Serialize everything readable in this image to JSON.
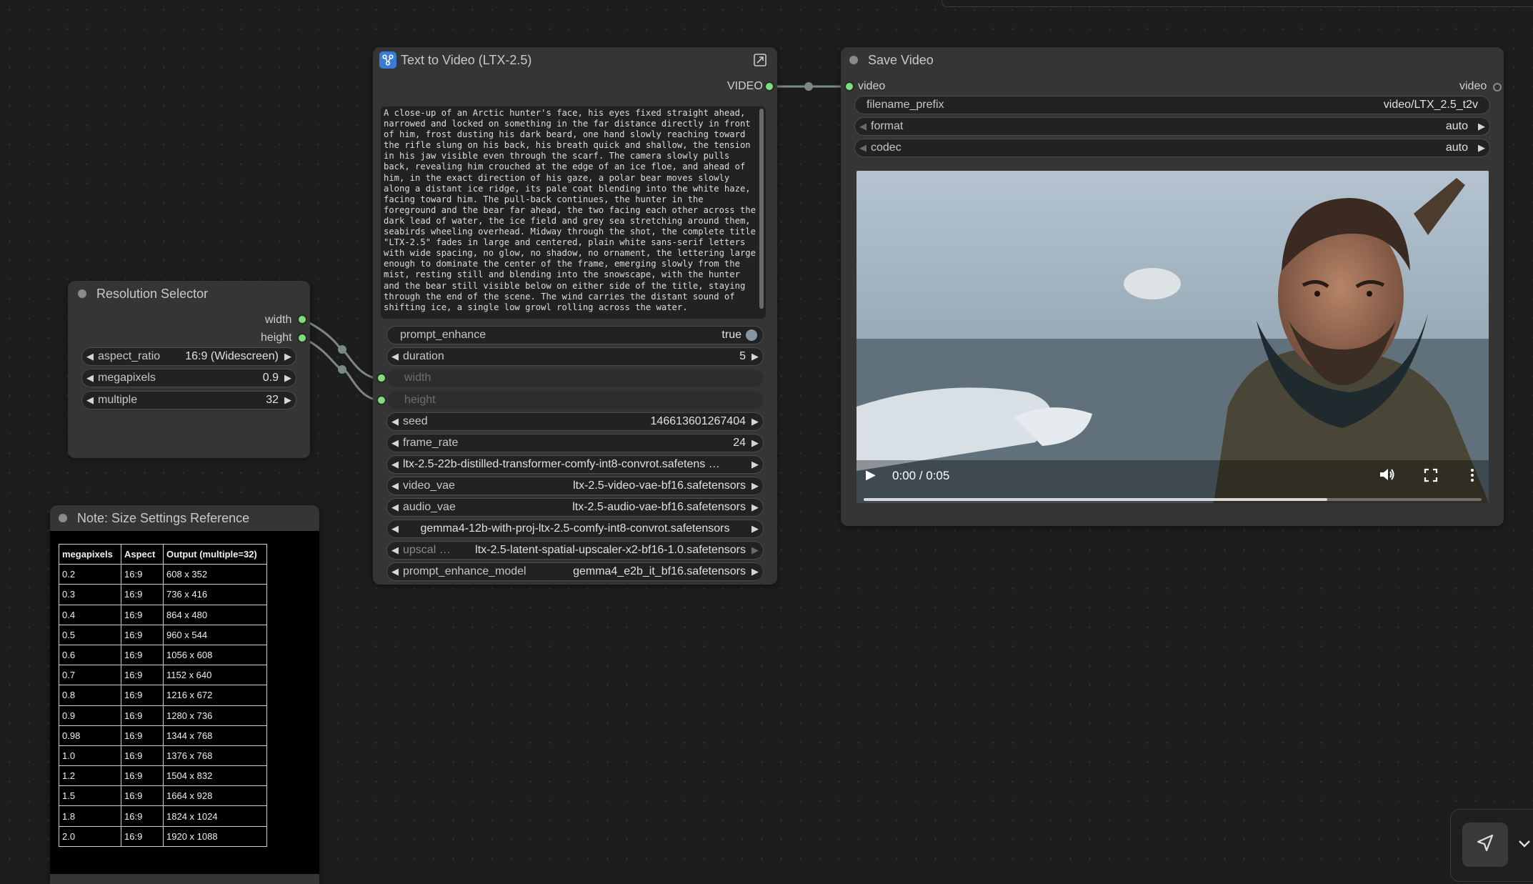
{
  "canvas": {
    "background": "#1d1d1d",
    "link_color": "#7a8a80"
  },
  "text_to_video": {
    "title": "Text to Video (LTX-2.5)",
    "output_label": "VIDEO",
    "prompt": "A close-up of an Arctic hunter's face, his eyes fixed straight ahead, narrowed and locked on something in the far distance directly in front of him, frost dusting his dark beard, one hand slowly reaching toward the rifle slung on his back, his breath quick and shallow, the tension in his jaw visible even through the scarf. The camera slowly pulls back, revealing him crouched at the edge of an ice floe, and ahead of him, in the exact direction of his gaze, a polar bear moves slowly along a distant ice ridge, its pale coat blending into the white haze, facing toward him. The pull-back continues, the hunter in the foreground and the bear far ahead, the two facing each other across the dark lead of water, the ice field and grey sea stretching around them, seabirds wheeling overhead. Midway through the shot, the complete title \"LTX-2.5\" fades in large and centered, plain white sans-serif letters with wide spacing, no glow, no shadow, no ornament, the lettering large enough to dominate the center of the frame, emerging slowly from the mist, resting still and blending into the snowscape, with the hunter and the bear still visible below on either side of the title, staying through the end of the scene. The wind carries the distant sound of shifting ice, a single low growl rolling across the water.",
    "prompt_enhance": {
      "label": "prompt_enhance",
      "value": "true"
    },
    "duration": {
      "label": "duration",
      "value": "5"
    },
    "width": {
      "label": "width"
    },
    "height": {
      "label": "height"
    },
    "seed": {
      "label": "seed",
      "value": "146613601267404"
    },
    "frame_rate": {
      "label": "frame_rate",
      "value": "24"
    },
    "model": {
      "value": "ltx-2.5-22b-distilled-transformer-comfy-int8-convrot.safetens …"
    },
    "video_vae": {
      "label": "video_vae",
      "value": "ltx-2.5-video-vae-bf16.safetensors"
    },
    "audio_vae": {
      "label": "audio_vae",
      "value": "ltx-2.5-audio-vae-bf16.safetensors"
    },
    "text_encoder": {
      "value": "gemma4-12b-with-proj-ltx-2.5-comfy-int8-convrot.safetensors"
    },
    "upscale": {
      "label": "upscal …",
      "value": "ltx-2.5-latent-spatial-upscaler-x2-bf16-1.0.safetensors"
    },
    "prompt_enhance_model": {
      "label": "prompt_enhance_model",
      "value": "gemma4_e2b_it_bf16.safetensors"
    }
  },
  "resolution_selector": {
    "title": "Resolution Selector",
    "outputs": [
      "width",
      "height"
    ],
    "aspect_ratio": {
      "label": "aspect_ratio",
      "value": "16:9 (Widescreen)"
    },
    "megapixels": {
      "label": "megapixels",
      "value": "0.9"
    },
    "multiple": {
      "label": "multiple",
      "value": "32"
    }
  },
  "save_video": {
    "title": "Save Video",
    "input_label": "video",
    "output_label": "video",
    "filename_prefix": {
      "label": "filename_prefix",
      "value": "video/LTX_2.5_t2v"
    },
    "format": {
      "label": "format",
      "value": "auto"
    },
    "codec": {
      "label": "codec",
      "value": "auto"
    },
    "player": {
      "time": "0:00 / 0:05",
      "progress": 0.75
    }
  },
  "note": {
    "title": "Note: Size Settings Reference",
    "headers": [
      "megapixels",
      "Aspect",
      "Output (multiple=32)"
    ],
    "rows": [
      [
        "0.2",
        "16:9",
        "608 x 352"
      ],
      [
        "0.3",
        "16:9",
        "736 x 416"
      ],
      [
        "0.4",
        "16:9",
        "864 x 480"
      ],
      [
        "0.5",
        "16:9",
        "960 x 544"
      ],
      [
        "0.6",
        "16:9",
        "1056 x 608"
      ],
      [
        "0.7",
        "16:9",
        "1152 x 640"
      ],
      [
        "0.8",
        "16:9",
        "1216 x 672"
      ],
      [
        "0.9",
        "16:9",
        "1280 x 736"
      ],
      [
        "0.98",
        "16:9",
        "1344 x 768"
      ],
      [
        "1.0",
        "16:9",
        "1376 x 768"
      ],
      [
        "1.2",
        "16:9",
        "1504 x 832"
      ],
      [
        "1.5",
        "16:9",
        "1664 x 928"
      ],
      [
        "1.8",
        "16:9",
        "1824 x 1024"
      ],
      [
        "2.0",
        "16:9",
        "1920 x 1088"
      ]
    ]
  }
}
